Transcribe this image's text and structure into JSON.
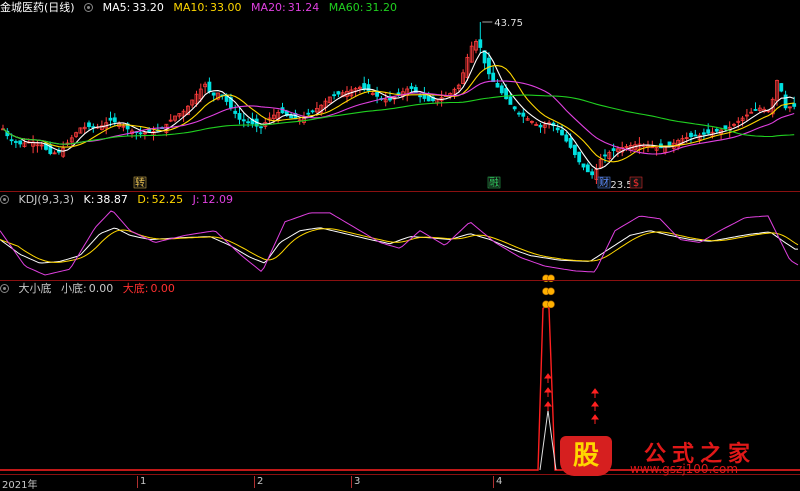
{
  "header1": {
    "title": "金城医药(日线)",
    "ma5_label": "MA5:",
    "ma5_value": "33.20",
    "ma10_label": "MA10:",
    "ma10_value": "33.00",
    "ma20_label": "MA20:",
    "ma20_value": "31.24",
    "ma60_label": "MA60:",
    "ma60_value": "31.20"
  },
  "header2": {
    "title": "KDJ(9,3,3)",
    "k_label": "K:",
    "k_value": "38.87",
    "d_label": "D:",
    "d_value": "52.25",
    "j_label": "J:",
    "j_value": "12.09"
  },
  "header3": {
    "title": "大小底",
    "small_label": "小底:",
    "small_value": "0.00",
    "big_label": "大底:",
    "big_value": "0.00"
  },
  "price_labels": {
    "high": "43.75",
    "low": "23.50"
  },
  "event_markers": [
    {
      "text": "转",
      "color": "#e8c050"
    },
    {
      "text": "融",
      "color": "#30d060"
    },
    {
      "text": "财",
      "color": "#5a8cff"
    },
    {
      "text": "$",
      "color": "#ff3030"
    }
  ],
  "time_axis": {
    "labels": [
      "2021年",
      "1",
      "2",
      "3",
      "4"
    ]
  },
  "watermark": {
    "logo_char": "股",
    "title": "公式之家",
    "url": "www.gszj100.com"
  },
  "colors": {
    "up": "#ff3c3c",
    "down": "#00e0e0",
    "ma5": "#ffffff",
    "ma10": "#ffd700",
    "ma20": "#e040e0",
    "ma60": "#20d020",
    "k": "#ffffff",
    "d": "#ffd700",
    "j": "#e040e0",
    "indicator": "#ff2020",
    "divider": "#8a1010"
  },
  "chart_data": [
    {
      "type": "candlestick",
      "title": "金城医药(日线)",
      "y_max_label": 43.75,
      "y_min_label": 23.5,
      "ylim": [
        23.0,
        44.5
      ],
      "series": [
        {
          "name": "MA5",
          "last": 33.2
        },
        {
          "name": "MA10",
          "last": 33.0
        },
        {
          "name": "MA20",
          "last": 31.24
        },
        {
          "name": "MA60",
          "last": 31.2
        }
      ],
      "close_anchors": [
        [
          0,
          31
        ],
        [
          10,
          29
        ],
        [
          20,
          28.5
        ],
        [
          30,
          28.8
        ],
        [
          40,
          28.6
        ],
        [
          50,
          27.3
        ],
        [
          60,
          27.5
        ],
        [
          70,
          29
        ],
        [
          80,
          30.5
        ],
        [
          90,
          30.7
        ],
        [
          100,
          30.6
        ],
        [
          110,
          31.5
        ],
        [
          120,
          31
        ],
        [
          130,
          30.2
        ],
        [
          140,
          29.8
        ],
        [
          160,
          30.2
        ],
        [
          175,
          32
        ],
        [
          185,
          32.7
        ],
        [
          195,
          34.5
        ],
        [
          205,
          36
        ],
        [
          212,
          34.5
        ],
        [
          220,
          35
        ],
        [
          230,
          33.2
        ],
        [
          240,
          31.5
        ],
        [
          250,
          31.2
        ],
        [
          260,
          30.5
        ],
        [
          270,
          31.8
        ],
        [
          280,
          32.6
        ],
        [
          290,
          31.8
        ],
        [
          300,
          31.5
        ],
        [
          310,
          32.4
        ],
        [
          320,
          33.2
        ],
        [
          330,
          34.4
        ],
        [
          340,
          34.8
        ],
        [
          350,
          35.2
        ],
        [
          360,
          35.6
        ],
        [
          370,
          35.1
        ],
        [
          380,
          34.2
        ],
        [
          390,
          34
        ],
        [
          400,
          34.8
        ],
        [
          410,
          35.6
        ],
        [
          420,
          34.5
        ],
        [
          430,
          33.8
        ],
        [
          440,
          34.2
        ],
        [
          450,
          34.8
        ],
        [
          460,
          36
        ],
        [
          470,
          40.5
        ],
        [
          478,
          41.6
        ],
        [
          486,
          38
        ],
        [
          492,
          36.5
        ],
        [
          500,
          35.2
        ],
        [
          510,
          33.5
        ],
        [
          520,
          32.2
        ],
        [
          530,
          31.5
        ],
        [
          540,
          30.6
        ],
        [
          550,
          31.2
        ],
        [
          560,
          30
        ],
        [
          570,
          28.2
        ],
        [
          580,
          26.1
        ],
        [
          588,
          25
        ],
        [
          594,
          24.5
        ],
        [
          600,
          26.5
        ],
        [
          610,
          27.5
        ],
        [
          620,
          28
        ],
        [
          630,
          28.3
        ],
        [
          640,
          28.5
        ],
        [
          650,
          28.2
        ],
        [
          660,
          28
        ],
        [
          670,
          28.3
        ],
        [
          680,
          29.1
        ],
        [
          690,
          29.4
        ],
        [
          700,
          29.6
        ],
        [
          710,
          29.9
        ],
        [
          720,
          30.2
        ],
        [
          730,
          30.6
        ],
        [
          740,
          31.5
        ],
        [
          750,
          32.4
        ],
        [
          760,
          33
        ],
        [
          770,
          32.6
        ],
        [
          778,
          37
        ],
        [
          785,
          33
        ],
        [
          792,
          33.2
        ]
      ]
    },
    {
      "type": "line",
      "title": "KDJ(9,3,3)",
      "ylim": [
        -10,
        110
      ],
      "series": [
        {
          "name": "K",
          "last": 38.87
        },
        {
          "name": "D",
          "last": 52.25
        },
        {
          "name": "J",
          "last": 12.09
        }
      ],
      "k_anchors": [
        [
          0,
          55
        ],
        [
          20,
          30
        ],
        [
          40,
          15
        ],
        [
          60,
          18
        ],
        [
          80,
          28
        ],
        [
          100,
          65
        ],
        [
          115,
          75
        ],
        [
          130,
          62
        ],
        [
          150,
          55
        ],
        [
          180,
          58
        ],
        [
          210,
          60
        ],
        [
          230,
          45
        ],
        [
          250,
          25
        ],
        [
          265,
          15
        ],
        [
          280,
          50
        ],
        [
          300,
          70
        ],
        [
          320,
          75
        ],
        [
          345,
          65
        ],
        [
          370,
          55
        ],
        [
          390,
          48
        ],
        [
          410,
          60
        ],
        [
          430,
          58
        ],
        [
          450,
          55
        ],
        [
          470,
          65
        ],
        [
          490,
          55
        ],
        [
          510,
          40
        ],
        [
          530,
          28
        ],
        [
          560,
          20
        ],
        [
          590,
          18
        ],
        [
          610,
          40
        ],
        [
          630,
          62
        ],
        [
          650,
          70
        ],
        [
          670,
          62
        ],
        [
          690,
          55
        ],
        [
          710,
          52
        ],
        [
          730,
          58
        ],
        [
          750,
          64
        ],
        [
          770,
          68
        ],
        [
          785,
          50
        ],
        [
          795,
          38.87
        ]
      ],
      "j_anchors": [
        [
          0,
          70
        ],
        [
          25,
          10
        ],
        [
          45,
          -5
        ],
        [
          70,
          5
        ],
        [
          95,
          75
        ],
        [
          112,
          105
        ],
        [
          130,
          70
        ],
        [
          155,
          50
        ],
        [
          185,
          62
        ],
        [
          215,
          70
        ],
        [
          240,
          30
        ],
        [
          262,
          0
        ],
        [
          285,
          85
        ],
        [
          310,
          100
        ],
        [
          330,
          100
        ],
        [
          355,
          75
        ],
        [
          380,
          50
        ],
        [
          400,
          40
        ],
        [
          420,
          70
        ],
        [
          445,
          45
        ],
        [
          470,
          85
        ],
        [
          495,
          50
        ],
        [
          520,
          25
        ],
        [
          545,
          10
        ],
        [
          575,
          2
        ],
        [
          595,
          0
        ],
        [
          615,
          70
        ],
        [
          640,
          95
        ],
        [
          660,
          90
        ],
        [
          680,
          55
        ],
        [
          700,
          50
        ],
        [
          720,
          70
        ],
        [
          745,
          92
        ],
        [
          768,
          95
        ],
        [
          790,
          20
        ],
        [
          798,
          12.09
        ]
      ]
    },
    {
      "type": "line",
      "title": "大小底",
      "ylim": [
        0,
        100
      ],
      "series": [
        {
          "name": "小底",
          "last": 0.0
        },
        {
          "name": "大底",
          "last": 0.0
        }
      ],
      "spikes": [
        {
          "index": 543,
          "value": 93
        },
        {
          "index": 549,
          "value": 93
        },
        {
          "index": 595,
          "value": 18
        }
      ]
    }
  ]
}
